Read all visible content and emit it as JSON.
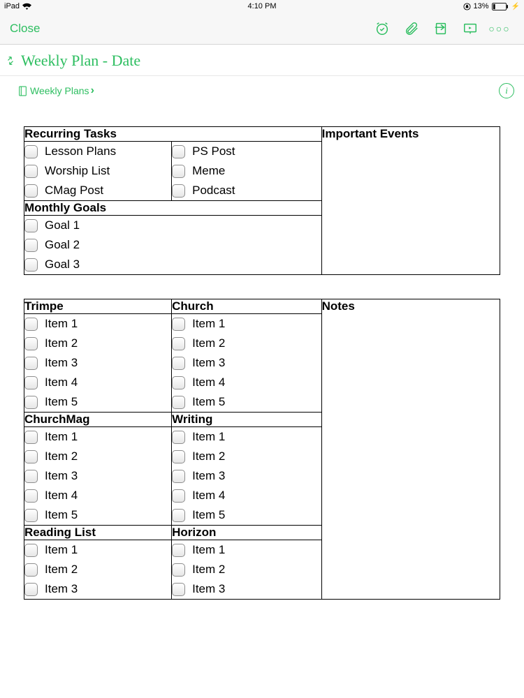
{
  "status": {
    "device": "iPad",
    "time": "4:10 PM",
    "battery_pct": "13%"
  },
  "toolbar": {
    "close_label": "Close"
  },
  "note": {
    "title": "Weekly Plan - Date",
    "notebook": "Weekly Plans"
  },
  "table1": {
    "recurring_header": "Recurring Tasks",
    "events_header": "Important Events",
    "monthly_header": "Monthly Goals",
    "recurring_col1": [
      "Lesson Plans",
      "Worship List",
      "CMag Post"
    ],
    "recurring_col2": [
      "PS Post",
      "Meme",
      "Podcast"
    ],
    "monthly_goals": [
      "Goal 1",
      "Goal 2",
      "Goal 3"
    ]
  },
  "table2": {
    "notes_header": "Notes",
    "sections": [
      {
        "left_h": "Trimpe",
        "right_h": "Church",
        "left": [
          "Item 1",
          "Item 2",
          "Item 3",
          "Item 4",
          "Item 5"
        ],
        "right": [
          "Item 1",
          "Item 2",
          "Item 3",
          "Item 4",
          "Item 5"
        ]
      },
      {
        "left_h": "ChurchMag",
        "right_h": "Writing",
        "left": [
          "Item 1",
          "Item 2",
          "Item 3",
          "Item 4",
          "Item 5"
        ],
        "right": [
          "Item 1",
          "Item 2",
          "Item 3",
          "Item 4",
          "Item 5"
        ]
      },
      {
        "left_h": "Reading List",
        "right_h": "Horizon",
        "left": [
          "Item 1",
          "Item 2",
          "Item 3"
        ],
        "right": [
          "Item 1",
          "Item 2",
          "Item 3"
        ]
      }
    ]
  }
}
